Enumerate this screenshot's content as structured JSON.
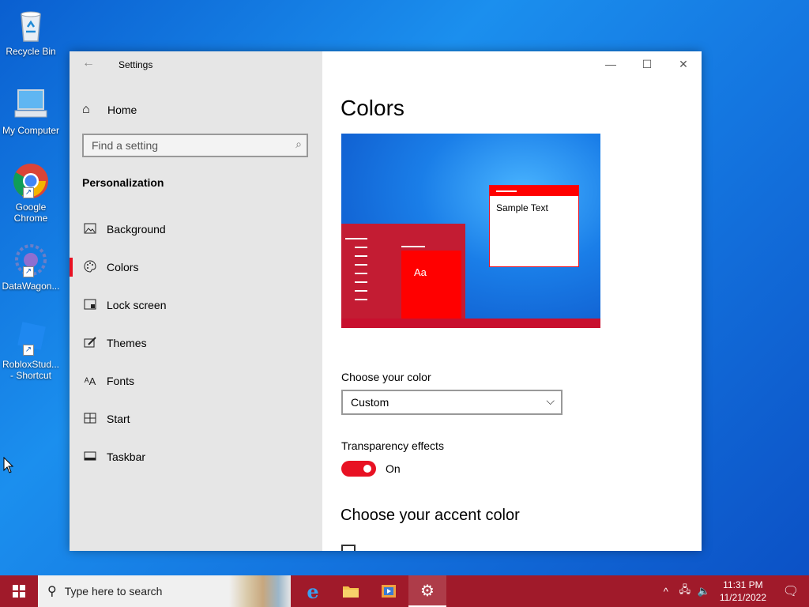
{
  "desktop": {
    "icons": [
      {
        "label": "Recycle Bin"
      },
      {
        "label": "My Computer"
      },
      {
        "label": "Google Chrome"
      },
      {
        "label": "DataWagon..."
      },
      {
        "label": "RobloxStud... - Shortcut"
      }
    ]
  },
  "window": {
    "title": "Settings",
    "nav": {
      "home_label": "Home",
      "search_placeholder": "Find a setting",
      "section_title": "Personalization",
      "items": [
        {
          "label": "Background",
          "icon": "image-icon"
        },
        {
          "label": "Colors",
          "icon": "palette-icon",
          "active": true
        },
        {
          "label": "Lock screen",
          "icon": "lock-screen-icon"
        },
        {
          "label": "Themes",
          "icon": "brush-icon"
        },
        {
          "label": "Fonts",
          "icon": "font-icon"
        },
        {
          "label": "Start",
          "icon": "start-icon"
        },
        {
          "label": "Taskbar",
          "icon": "taskbar-icon"
        }
      ]
    },
    "content": {
      "page_title": "Colors",
      "preview": {
        "sample_text": "Sample Text",
        "tile_text": "Aa"
      },
      "choose_color_label": "Choose your color",
      "choose_color_value": "Custom",
      "transparency_label": "Transparency effects",
      "transparency_state": "On",
      "accent_title": "Choose your accent color"
    }
  },
  "taskbar": {
    "search_placeholder": "Type here to search",
    "time": "11:31 PM",
    "date": "11/21/2022"
  },
  "colors": {
    "accent": "#e81123",
    "taskbar": "#a01a2a"
  }
}
